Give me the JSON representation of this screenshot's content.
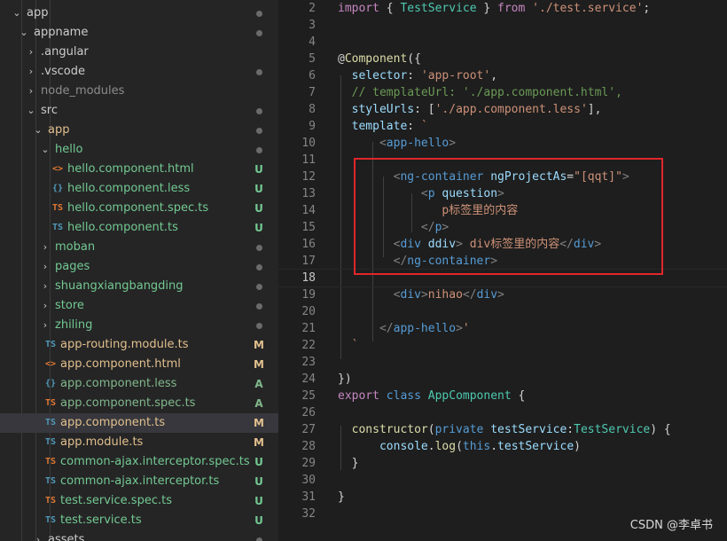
{
  "explorer": {
    "items": [
      {
        "label": "app",
        "kind": "folder",
        "open": true,
        "depth": 2,
        "icon": "",
        "status": "dot",
        "color": "#cccccc"
      },
      {
        "label": "appname",
        "kind": "folder",
        "open": true,
        "depth": 3,
        "icon": "",
        "status": "dot",
        "color": "#cccccc"
      },
      {
        "label": ".angular",
        "kind": "folder",
        "open": false,
        "depth": 4,
        "icon": "",
        "status": "",
        "color": "#cccccc"
      },
      {
        "label": ".vscode",
        "kind": "folder",
        "open": false,
        "depth": 4,
        "icon": "",
        "status": "dot",
        "color": "#cccccc"
      },
      {
        "label": "node_modules",
        "kind": "folder",
        "open": false,
        "depth": 4,
        "icon": "",
        "status": "",
        "color": "#8c8c8c"
      },
      {
        "label": "src",
        "kind": "folder",
        "open": true,
        "depth": 4,
        "icon": "",
        "status": "dot",
        "color": "#cccccc"
      },
      {
        "label": "app",
        "kind": "folder",
        "open": true,
        "depth": 5,
        "icon": "",
        "status": "dot",
        "color": "#e2c08d"
      },
      {
        "label": "hello",
        "kind": "folder",
        "open": true,
        "depth": 6,
        "icon": "",
        "status": "dot",
        "color": "#73c991"
      },
      {
        "label": "hello.component.html",
        "kind": "file",
        "depth": 7,
        "icon": "<>",
        "icon_color": "#e37933",
        "status": "U",
        "color": "#73c991"
      },
      {
        "label": "hello.component.less",
        "kind": "file",
        "depth": 7,
        "icon": "{}",
        "icon_color": "#519aba",
        "status": "U",
        "color": "#73c991"
      },
      {
        "label": "hello.component.spec.ts",
        "kind": "file",
        "depth": 7,
        "icon": "TS",
        "icon_color": "#e37933",
        "status": "U",
        "color": "#73c991"
      },
      {
        "label": "hello.component.ts",
        "kind": "file",
        "depth": 7,
        "icon": "TS",
        "icon_color": "#519aba",
        "status": "U",
        "color": "#73c991"
      },
      {
        "label": "moban",
        "kind": "folder",
        "open": false,
        "depth": 6,
        "icon": "",
        "status": "dot",
        "color": "#73c991"
      },
      {
        "label": "pages",
        "kind": "folder",
        "open": false,
        "depth": 6,
        "icon": "",
        "status": "dot",
        "color": "#73c991"
      },
      {
        "label": "shuangxiangbangding",
        "kind": "folder",
        "open": false,
        "depth": 6,
        "icon": "",
        "status": "dot",
        "color": "#73c991"
      },
      {
        "label": "store",
        "kind": "folder",
        "open": false,
        "depth": 6,
        "icon": "",
        "status": "dot",
        "color": "#73c991"
      },
      {
        "label": "zhiling",
        "kind": "folder",
        "open": false,
        "depth": 6,
        "icon": "",
        "status": "dot",
        "color": "#73c991"
      },
      {
        "label": "app-routing.module.ts",
        "kind": "file",
        "depth": 6,
        "icon": "TS",
        "icon_color": "#519aba",
        "status": "M",
        "color": "#e2c08d"
      },
      {
        "label": "app.component.html",
        "kind": "file",
        "depth": 6,
        "icon": "<>",
        "icon_color": "#e37933",
        "status": "M",
        "color": "#e2c08d"
      },
      {
        "label": "app.component.less",
        "kind": "file",
        "depth": 6,
        "icon": "{}",
        "icon_color": "#519aba",
        "status": "A",
        "color": "#81b88b"
      },
      {
        "label": "app.component.spec.ts",
        "kind": "file",
        "depth": 6,
        "icon": "TS",
        "icon_color": "#e37933",
        "status": "A",
        "color": "#81b88b"
      },
      {
        "label": "app.component.ts",
        "kind": "file",
        "depth": 6,
        "icon": "TS",
        "icon_color": "#519aba",
        "status": "M",
        "color": "#e2c08d",
        "selected": true
      },
      {
        "label": "app.module.ts",
        "kind": "file",
        "depth": 6,
        "icon": "TS",
        "icon_color": "#519aba",
        "status": "M",
        "color": "#e2c08d"
      },
      {
        "label": "common-ajax.interceptor.spec.ts",
        "kind": "file",
        "depth": 6,
        "icon": "TS",
        "icon_color": "#e37933",
        "status": "U",
        "color": "#73c991"
      },
      {
        "label": "common-ajax.interceptor.ts",
        "kind": "file",
        "depth": 6,
        "icon": "TS",
        "icon_color": "#519aba",
        "status": "U",
        "color": "#73c991"
      },
      {
        "label": "test.service.spec.ts",
        "kind": "file",
        "depth": 6,
        "icon": "TS",
        "icon_color": "#e37933",
        "status": "U",
        "color": "#73c991"
      },
      {
        "label": "test.service.ts",
        "kind": "file",
        "depth": 6,
        "icon": "TS",
        "icon_color": "#519aba",
        "status": "U",
        "color": "#73c991"
      },
      {
        "label": "assets",
        "kind": "folder",
        "open": false,
        "depth": 5,
        "icon": "",
        "status": "dot",
        "color": "#cccccc"
      }
    ]
  },
  "editor": {
    "current_line": "18",
    "lines": [
      {
        "n": "2",
        "t": [
          [
            "kw2",
            "import"
          ],
          [
            "pun",
            " { "
          ],
          [
            "cls",
            "TestService"
          ],
          [
            "pun",
            " } "
          ],
          [
            "kw2",
            "from"
          ],
          [
            "pun",
            " "
          ],
          [
            "str",
            "'./test.service'"
          ],
          [
            "pun",
            ";"
          ]
        ]
      },
      {
        "n": "3",
        "t": []
      },
      {
        "n": "4",
        "t": []
      },
      {
        "n": "5",
        "t": [
          [
            "pun",
            "@"
          ],
          [
            "dec",
            "Component"
          ],
          [
            "pun",
            "({"
          ]
        ]
      },
      {
        "n": "6",
        "t": [
          [
            "pun",
            "  "
          ],
          [
            "prop",
            "selector"
          ],
          [
            "pun",
            ": "
          ],
          [
            "str",
            "'app-root'"
          ],
          [
            "pun",
            ","
          ]
        ]
      },
      {
        "n": "7",
        "t": [
          [
            "pun",
            "  "
          ],
          [
            "cmt",
            "// templateUrl: './app.component.html',"
          ]
        ]
      },
      {
        "n": "8",
        "t": [
          [
            "pun",
            "  "
          ],
          [
            "prop",
            "styleUrls"
          ],
          [
            "pun",
            ": ["
          ],
          [
            "str",
            "'./app.component.less'"
          ],
          [
            "pun",
            "],"
          ]
        ]
      },
      {
        "n": "9",
        "t": [
          [
            "pun",
            "  "
          ],
          [
            "prop",
            "template"
          ],
          [
            "pun",
            ": "
          ],
          [
            "str",
            "`"
          ]
        ]
      },
      {
        "n": "10",
        "t": [
          [
            "pun",
            "      "
          ],
          [
            "lt",
            "<"
          ],
          [
            "tag",
            "app-hello"
          ],
          [
            "lt",
            ">"
          ]
        ]
      },
      {
        "n": "11",
        "t": []
      },
      {
        "n": "12",
        "t": [
          [
            "pun",
            "        "
          ],
          [
            "lt",
            "<"
          ],
          [
            "tag",
            "ng-container"
          ],
          [
            "pun",
            " "
          ],
          [
            "attr",
            "ngProjectAs"
          ],
          [
            "pun",
            "="
          ],
          [
            "str",
            "\"[qqt]\""
          ],
          [
            "lt",
            ">"
          ]
        ]
      },
      {
        "n": "13",
        "t": [
          [
            "pun",
            "            "
          ],
          [
            "lt",
            "<"
          ],
          [
            "tag",
            "p"
          ],
          [
            "pun",
            " "
          ],
          [
            "attr",
            "question"
          ],
          [
            "lt",
            ">"
          ]
        ]
      },
      {
        "n": "14",
        "t": [
          [
            "pun",
            "               "
          ],
          [
            "str",
            "p标签里的内容"
          ]
        ]
      },
      {
        "n": "15",
        "t": [
          [
            "pun",
            "            "
          ],
          [
            "lt",
            "</"
          ],
          [
            "tag",
            "p"
          ],
          [
            "lt",
            ">"
          ]
        ]
      },
      {
        "n": "16",
        "t": [
          [
            "pun",
            "        "
          ],
          [
            "lt",
            "<"
          ],
          [
            "tag",
            "div"
          ],
          [
            "pun",
            " "
          ],
          [
            "attr",
            "ddiv"
          ],
          [
            "lt",
            ">"
          ],
          [
            "str",
            " div标签里的内容"
          ],
          [
            "lt",
            "</"
          ],
          [
            "tag",
            "div"
          ],
          [
            "lt",
            ">"
          ]
        ]
      },
      {
        "n": "17",
        "t": [
          [
            "pun",
            "        "
          ],
          [
            "lt",
            "</"
          ],
          [
            "tag",
            "ng-container"
          ],
          [
            "lt",
            ">"
          ]
        ]
      },
      {
        "n": "18",
        "t": []
      },
      {
        "n": "19",
        "t": [
          [
            "pun",
            "        "
          ],
          [
            "lt",
            "<"
          ],
          [
            "tag",
            "div"
          ],
          [
            "lt",
            ">"
          ],
          [
            "str",
            "nihao"
          ],
          [
            "lt",
            "</"
          ],
          [
            "tag",
            "div"
          ],
          [
            "lt",
            ">"
          ]
        ]
      },
      {
        "n": "20",
        "t": []
      },
      {
        "n": "21",
        "t": [
          [
            "pun",
            "      "
          ],
          [
            "lt",
            "</"
          ],
          [
            "tag",
            "app-hello"
          ],
          [
            "lt",
            ">"
          ],
          [
            "str",
            "'"
          ]
        ]
      },
      {
        "n": "22",
        "t": [
          [
            "pun",
            "  "
          ],
          [
            "str",
            "`"
          ]
        ]
      },
      {
        "n": "23",
        "t": []
      },
      {
        "n": "24",
        "t": [
          [
            "pun",
            "})"
          ]
        ]
      },
      {
        "n": "25",
        "t": [
          [
            "kw2",
            "export"
          ],
          [
            "pun",
            " "
          ],
          [
            "kw",
            "class"
          ],
          [
            "pun",
            " "
          ],
          [
            "cls",
            "AppComponent"
          ],
          [
            "pun",
            " {"
          ]
        ]
      },
      {
        "n": "26",
        "t": []
      },
      {
        "n": "27",
        "t": [
          [
            "pun",
            "  "
          ],
          [
            "fn",
            "constructor"
          ],
          [
            "pun",
            "("
          ],
          [
            "kw",
            "private"
          ],
          [
            "pun",
            " "
          ],
          [
            "prop",
            "testService"
          ],
          [
            "pun",
            ":"
          ],
          [
            "cls",
            "TestService"
          ],
          [
            "pun",
            ") {"
          ]
        ]
      },
      {
        "n": "28",
        "t": [
          [
            "pun",
            "      "
          ],
          [
            "prop",
            "console"
          ],
          [
            "pun",
            "."
          ],
          [
            "fn",
            "log"
          ],
          [
            "pun",
            "("
          ],
          [
            "kw",
            "this"
          ],
          [
            "pun",
            "."
          ],
          [
            "prop",
            "testService"
          ],
          [
            "pun",
            ")"
          ]
        ]
      },
      {
        "n": "29",
        "t": [
          [
            "pun",
            "  }"
          ]
        ]
      },
      {
        "n": "30",
        "t": []
      },
      {
        "n": "31",
        "t": [
          [
            "pun",
            "}"
          ]
        ]
      },
      {
        "n": "32",
        "t": []
      }
    ]
  },
  "watermark": "CSDN @李卓书"
}
